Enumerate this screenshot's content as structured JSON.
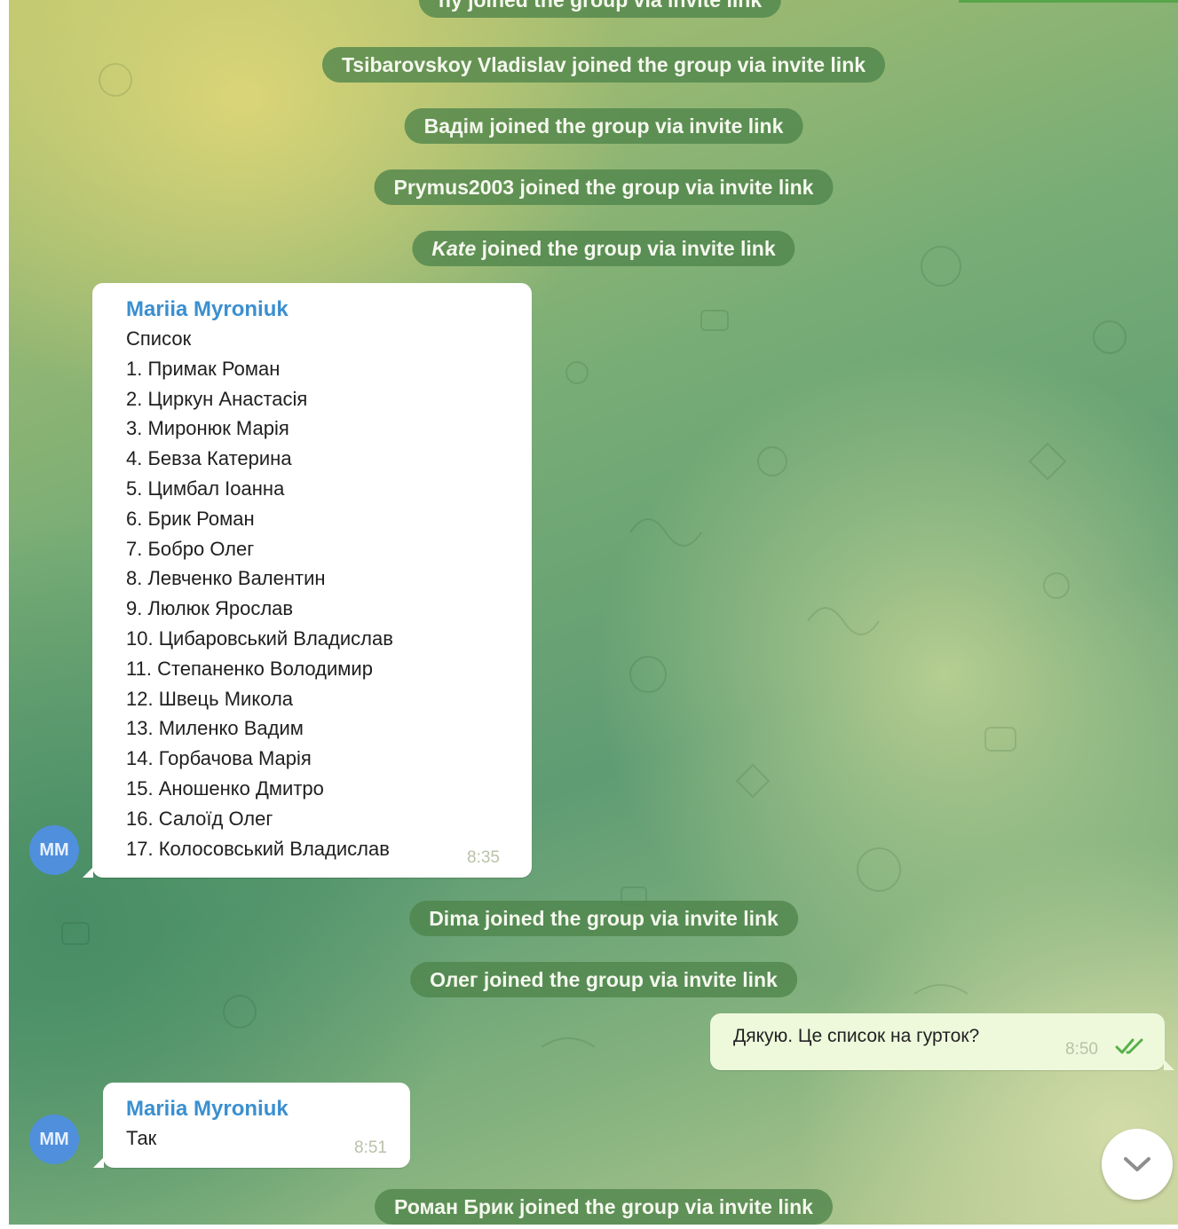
{
  "chat": {
    "service_messages": [
      {
        "id": "partial",
        "name": "",
        "action": "ny joined the group via invite link"
      },
      {
        "id": "tsibarovskoy",
        "name": "Tsibarovskoy Vladislav",
        "action": " joined the group via invite link"
      },
      {
        "id": "vadim",
        "name": "Вадім",
        "action": " joined the group via invite link"
      },
      {
        "id": "prymus",
        "name": "Prymus2003",
        "action": " joined the group via invite link"
      },
      {
        "id": "kate",
        "name": "Kate",
        "action": " joined the group via invite link"
      },
      {
        "id": "dima",
        "name": "Dima",
        "action": " joined the group via invite link"
      },
      {
        "id": "oleg",
        "name": "Олег",
        "action": " joined the group via invite link"
      },
      {
        "id": "roman",
        "name": "Роман Брик",
        "action": " joined the group via invite link"
      }
    ],
    "message_list": {
      "sender": "Mariia Myroniuk",
      "lines": [
        "Список",
        "1. Примак Роман",
        "2. Циркун Анастасія",
        "3. Миронюк Марія",
        "4. Бевза Катерина",
        "5. Цимбал Іоанна",
        "6. Брик Роман",
        "7. Бобро Олег",
        "8. Левченко Валентин",
        "9. Люлюк Ярослав",
        "10. Цибаровський Владислав",
        "11. Степаненко Володимир",
        "12. Швець Микола",
        "13. Миленко Вадим",
        "14. Горбачова Марія",
        "15. Аношенко Дмитро",
        "16. Салоїд Олег",
        "17. Колосовський Владислав"
      ],
      "time": "8:35",
      "avatar_initials": "MM"
    },
    "message_out": {
      "text": "Дякую. Це список на гурток?",
      "time": "8:50",
      "status_icon": "double-check-icon"
    },
    "message_reply": {
      "sender": "Mariia Myroniuk",
      "text": "Так",
      "time": "8:51",
      "avatar_initials": "MM"
    },
    "scroll_button_icon": "chevron-down-icon"
  },
  "colors": {
    "service_bg": "#4e844a",
    "sender_name": "#3a8fd0",
    "avatar": "#4f8fdc",
    "outgoing_bubble": "#eef9dc",
    "read_check": "#58b04a"
  }
}
